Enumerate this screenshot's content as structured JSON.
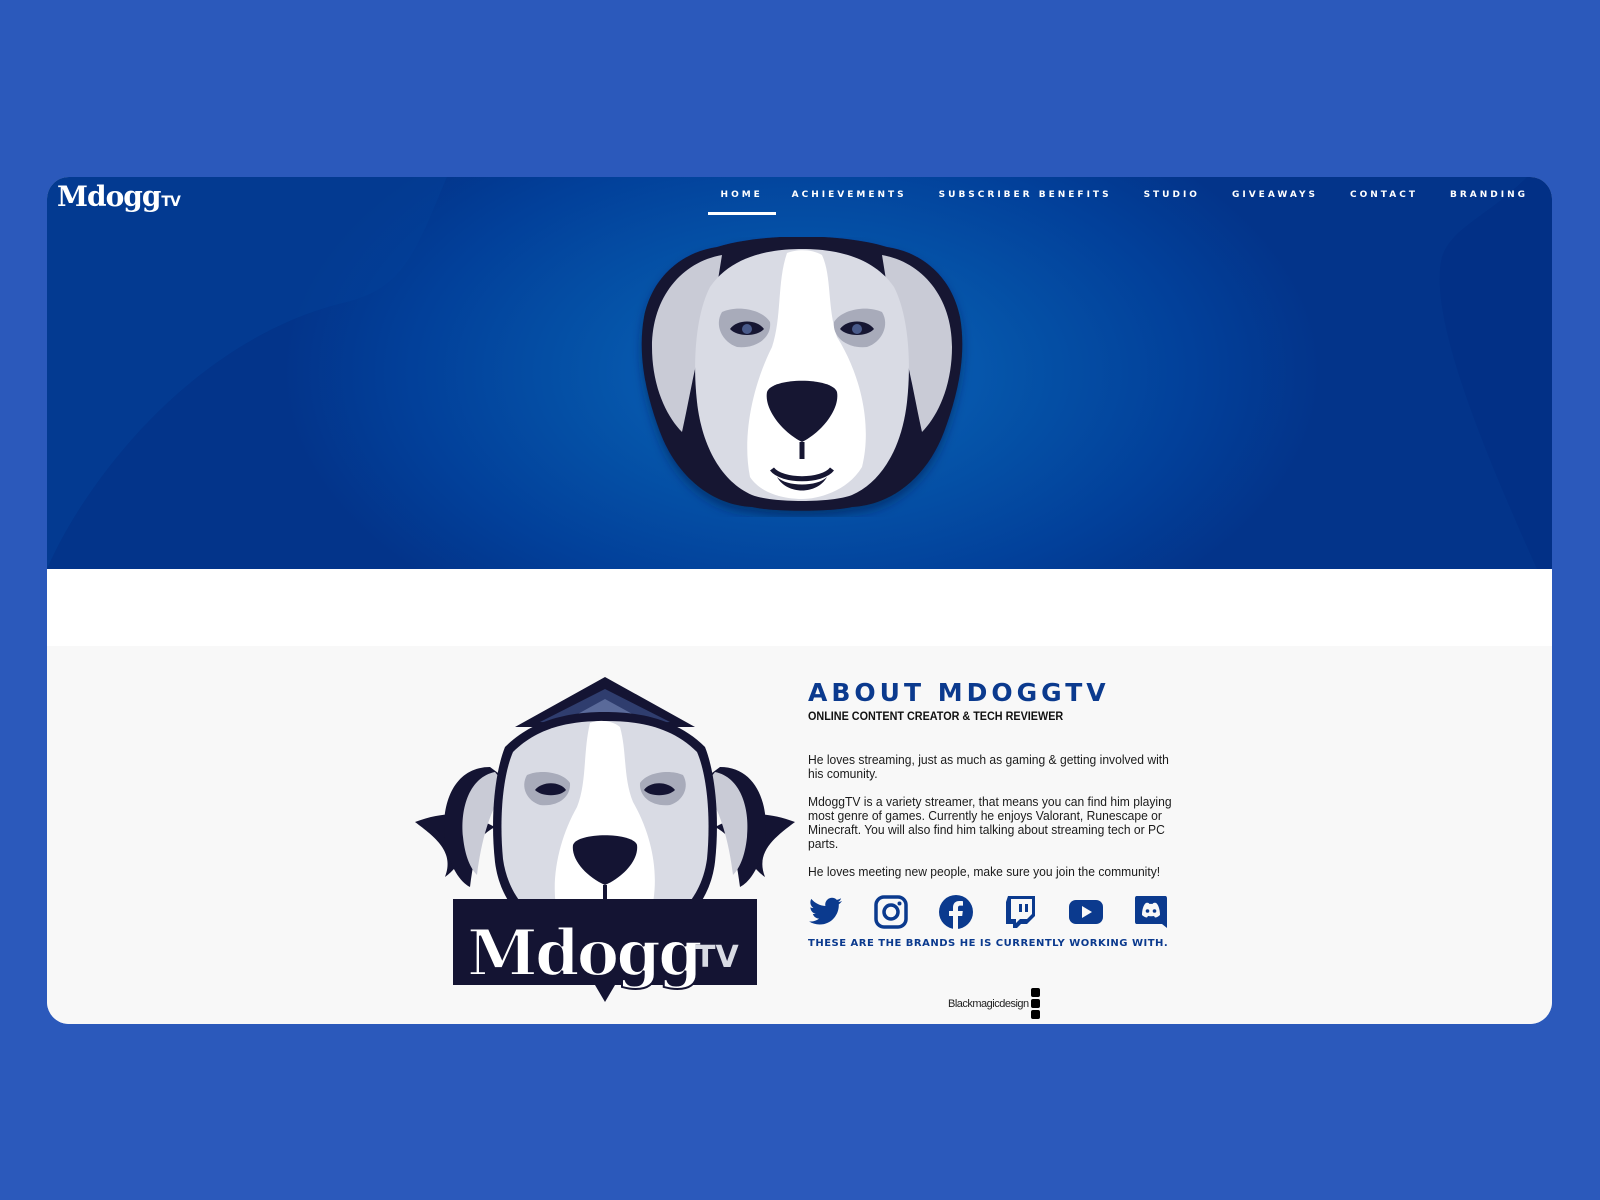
{
  "brand": {
    "logo_main": "Mdogg",
    "logo_suffix": "TV"
  },
  "nav": {
    "items": [
      {
        "label": "HOME",
        "active": true
      },
      {
        "label": "ACHIEVEMENTS",
        "active": false
      },
      {
        "label": "SUBSCRIBER BENEFITS",
        "active": false
      },
      {
        "label": "STUDIO",
        "active": false
      },
      {
        "label": "GIVEAWAYS",
        "active": false
      },
      {
        "label": "CONTACT",
        "active": false
      },
      {
        "label": "BRANDING",
        "active": false
      }
    ]
  },
  "about": {
    "title": "ABOUT MDOGGTV",
    "subtitle": "ONLINE CONTENT CREATOR & TECH REVIEWER",
    "paragraphs": [
      "He loves streaming, just as much as gaming & getting involved with his comunity.",
      "MdoggTV is a variety streamer, that means you can find him playing most genre of games. Currently he enjoys Valorant, Runescape or Minecraft. You will also find him talking about streaming tech or PC parts.",
      "He loves meeting new people, make sure you join the community!"
    ],
    "socials": [
      "twitter-icon",
      "instagram-icon",
      "facebook-icon",
      "twitch-icon",
      "youtube-icon",
      "discord-icon"
    ],
    "brands_heading": "THESE ARE THE BRANDS HE IS CURRENTLY WORKING WITH.",
    "badge_text_main": "Mdogg",
    "badge_text_suffix": "TV"
  },
  "partners": {
    "blackmagic": "Blackmagicdesign"
  },
  "colors": {
    "page_bg": "#2b59bb",
    "hero_blue": "#0553a8",
    "accent_navy": "#0b3a8e",
    "dog_dark": "#141433",
    "section_bg": "#f8f8f8"
  }
}
